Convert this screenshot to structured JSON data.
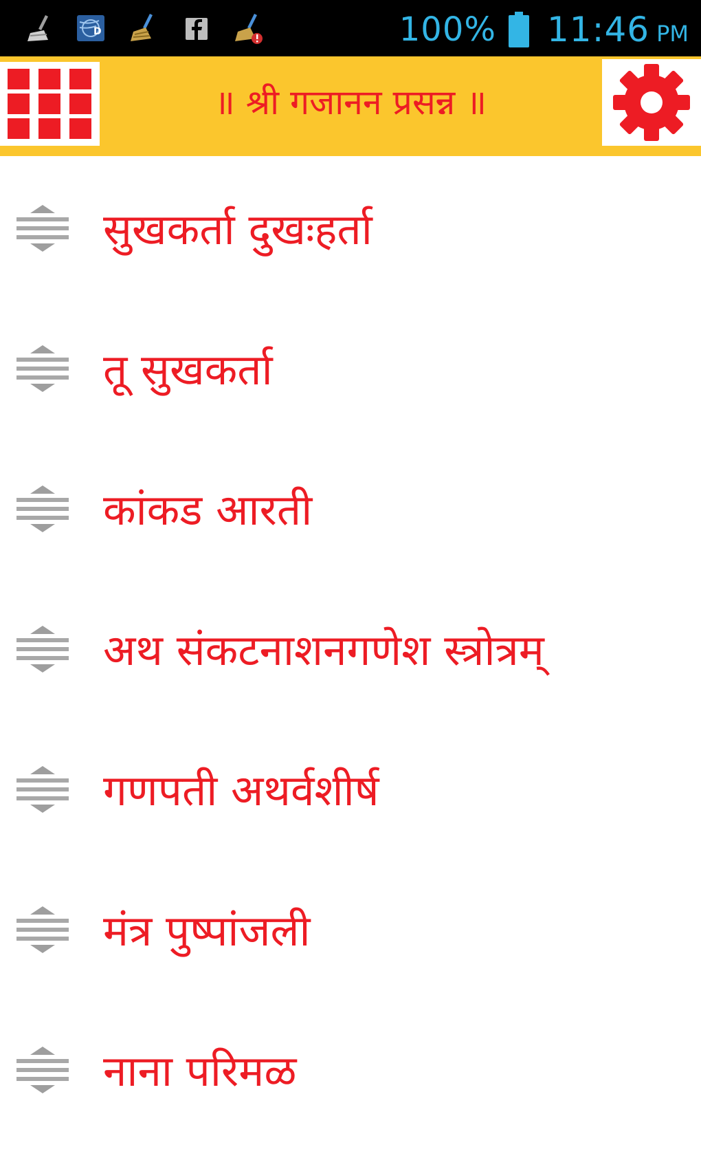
{
  "status_bar": {
    "icons": [
      "cleaner-icon",
      "notification-app-icon",
      "broom-icon",
      "facebook-icon",
      "broom-alert-icon"
    ],
    "battery_percent": "100%",
    "time": "11:46",
    "ampm": "PM",
    "color": "#33b5e5"
  },
  "header": {
    "title": "॥ श्री गजानन प्रसन्न ॥",
    "background": "#fbc62d",
    "accent": "#ed1c24"
  },
  "list": {
    "items": [
      {
        "label": "सुखकर्ता दुखःहर्ता"
      },
      {
        "label": "तू सुखकर्ता"
      },
      {
        "label": "कांकड आरती"
      },
      {
        "label": "अथ संकटनाशनगणेश स्त्रोत्रम्"
      },
      {
        "label": "गणपती अथर्वशीर्ष"
      },
      {
        "label": "मंत्र पुष्पांजली"
      },
      {
        "label": "नाना परिमळ"
      }
    ]
  }
}
